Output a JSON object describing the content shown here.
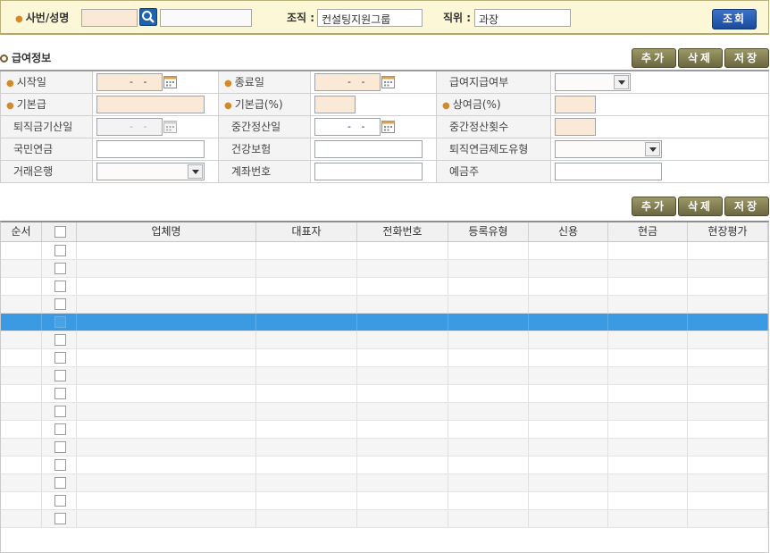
{
  "search": {
    "emp_label": "사번/성명",
    "emp_id_value": "",
    "emp_name_value": "",
    "org_label": "조직 :",
    "org_value": "컨설팅지원그룹",
    "position_label": "직위 :",
    "position_value": "과장",
    "inquiry_button": "조회"
  },
  "section": {
    "title": "급여정보"
  },
  "toolbar1": {
    "add": "추가",
    "delete": "삭제",
    "save": "저장"
  },
  "toolbar2": {
    "add": "추가",
    "delete": "삭제",
    "save": "저장"
  },
  "form": {
    "start_date_label": "시작일",
    "start_date_value": "- -",
    "end_date_label": "종료일",
    "end_date_value": "- -",
    "pay_flag_label": "급여지급여부",
    "base_pay_label": "기본급",
    "base_pay_pct_label": "기본급(%)",
    "bonus_pct_label": "상여금(%)",
    "retire_calc_label": "퇴직금기산일",
    "retire_calc_value": "- -",
    "mid_settle_date_label": "중간정산일",
    "mid_settle_date_value": "- -",
    "mid_settle_count_label": "중간정산횟수",
    "pension_label": "국민연금",
    "health_label": "건강보험",
    "retire_pension_type_label": "퇴직연금제도유형",
    "bank_label": "거래은행",
    "account_label": "계좌번호",
    "holder_label": "예금주"
  },
  "grid": {
    "columns": [
      "순서",
      "",
      "업체명",
      "대표자",
      "전화번호",
      "등록유형",
      "신용",
      "현금",
      "현장평가"
    ],
    "row_count": 16,
    "selected_row": 4
  },
  "colors": {
    "selected_row": "#3b9ae1",
    "search_bg": "#fcf8d7",
    "button_olive": "#7f7a4f",
    "button_blue": "#1a4b9a",
    "required_mark": "#d08a2a"
  }
}
